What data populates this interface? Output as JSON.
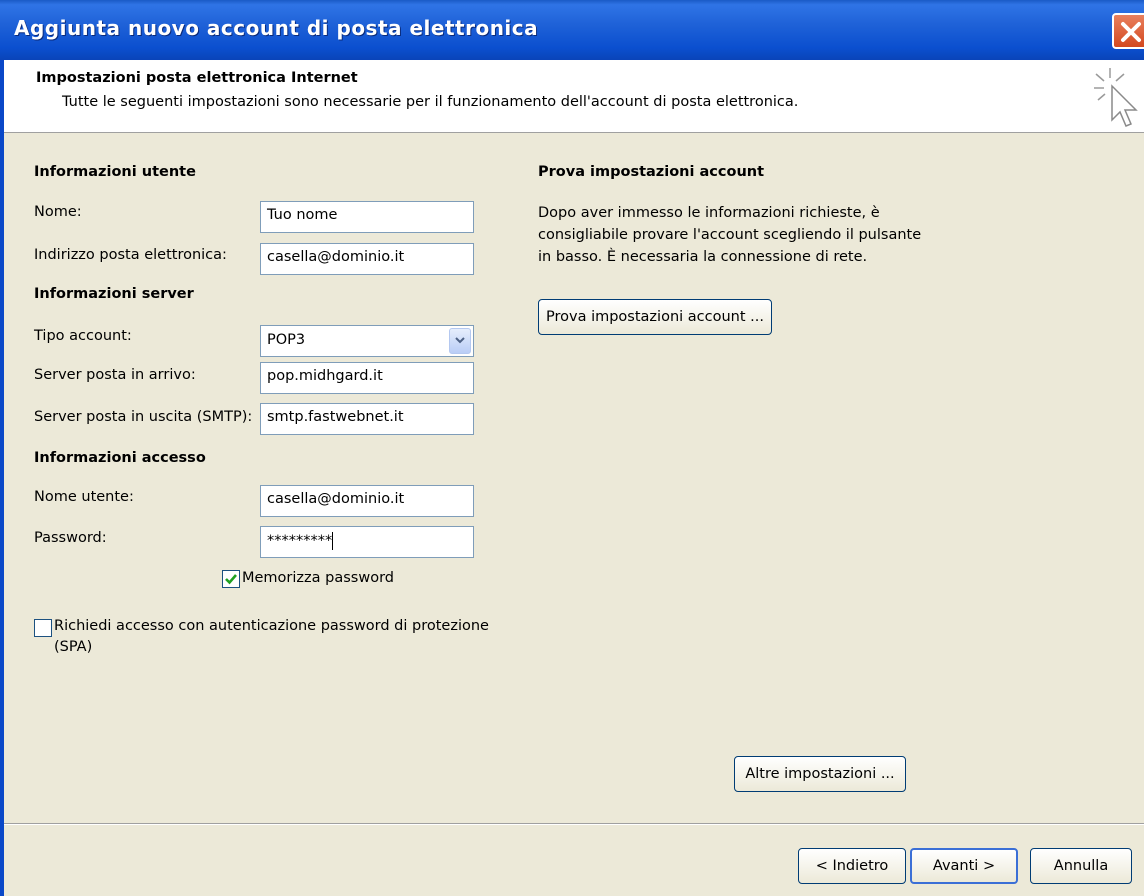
{
  "window": {
    "title": "Aggiunta nuovo account di posta elettronica"
  },
  "header": {
    "title": "Impostazioni posta elettronica Internet",
    "subtitle": "Tutte le seguenti impostazioni sono necessarie per il funzionamento dell'account di posta elettronica."
  },
  "user_info": {
    "heading": "Informazioni utente",
    "name_label": "Nome:",
    "name_value": "Tuo nome",
    "email_label": "Indirizzo posta elettronica:",
    "email_value": "casella@dominio.it"
  },
  "server_info": {
    "heading": "Informazioni server",
    "account_type_label": "Tipo account:",
    "account_type_value": "POP3",
    "incoming_label": "Server posta in arrivo:",
    "incoming_value": "pop.midhgard.it",
    "outgoing_label": "Server posta in uscita (SMTP):",
    "outgoing_value": "smtp.fastwebnet.it"
  },
  "access_info": {
    "heading": "Informazioni accesso",
    "username_label": "Nome utente:",
    "username_value": "casella@dominio.it",
    "password_label": "Password:",
    "password_value": "*********",
    "remember_label": "Memorizza password",
    "spa_label_line1": "Richiedi accesso con autenticazione password di protezione",
    "spa_label_line2": "(SPA)"
  },
  "test": {
    "heading": "Prova impostazioni account",
    "desc_line1": "Dopo aver immesso le informazioni richieste, è",
    "desc_line2": "consigliabile provare l'account scegliendo il pulsante",
    "desc_line3": "in basso. È necessaria la connessione di rete.",
    "button": "Prova impostazioni account ..."
  },
  "more_settings": "Altre impostazioni ...",
  "footer": {
    "back": "< Indietro",
    "next": "Avanti >",
    "cancel": "Annulla"
  },
  "colors": {
    "title_blue": "#0b4fcf",
    "face": "#ece9d8",
    "check_green": "#21a121"
  }
}
